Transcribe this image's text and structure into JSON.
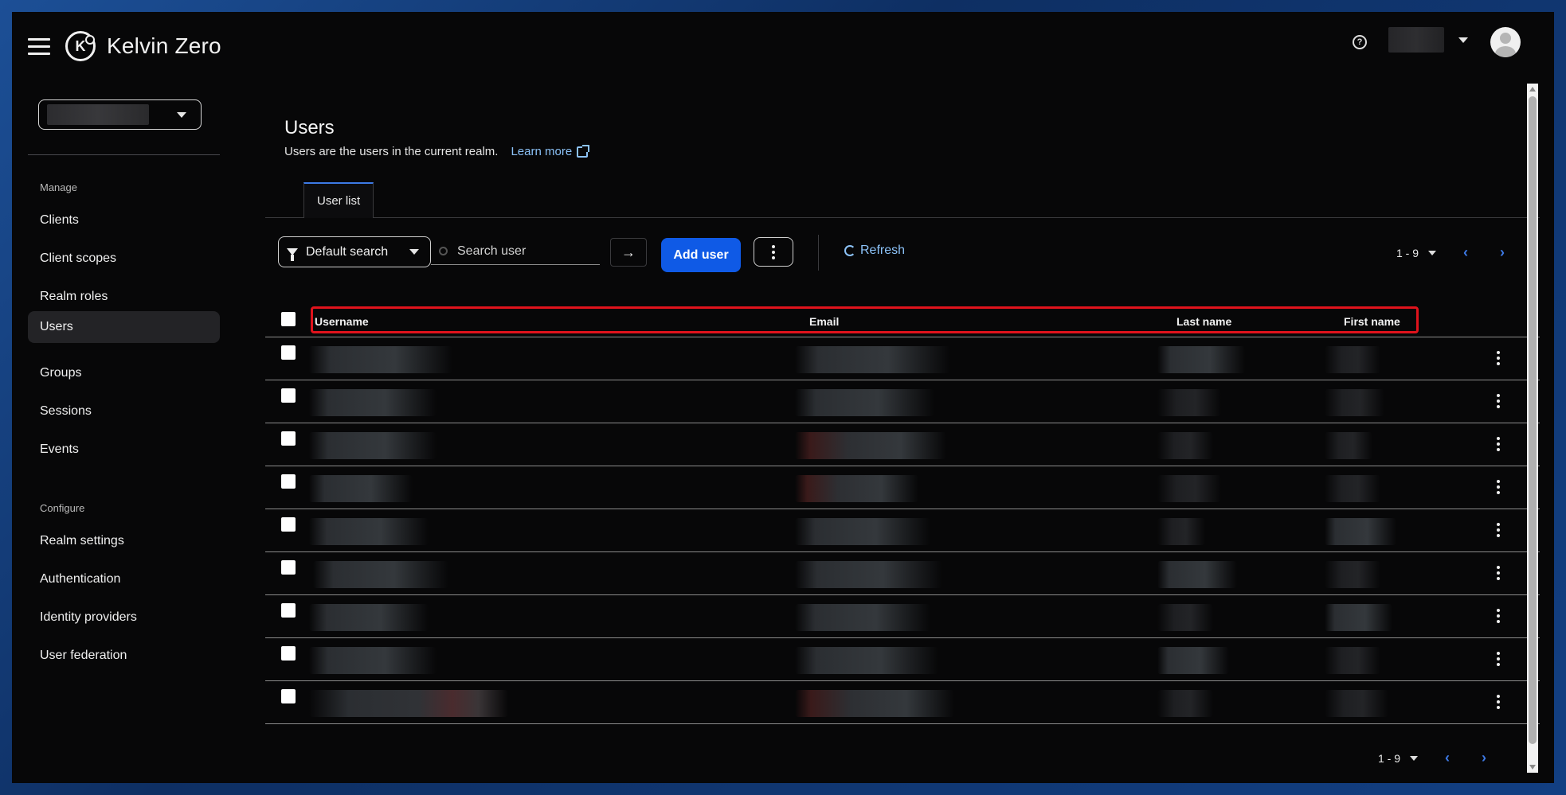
{
  "header": {
    "app_title": "Kelvin Zero",
    "logo_letter": "K",
    "help_icon_glyph": "?"
  },
  "sidebar": {
    "sections": [
      {
        "label": "Manage",
        "items": [
          "Clients",
          "Client scopes",
          "Realm roles",
          "Users",
          "Groups",
          "Sessions",
          "Events"
        ]
      },
      {
        "label": "Configure",
        "items": [
          "Realm settings",
          "Authentication",
          "Identity providers",
          "User federation"
        ]
      }
    ],
    "active_item": "Users"
  },
  "page": {
    "title": "Users",
    "subtitle": "Users are the users in the current realm.",
    "learn_more": "Learn more"
  },
  "tabs": [
    {
      "label": "User list",
      "active": true
    }
  ],
  "toolbar": {
    "filter_label": "Default search",
    "search_placeholder": "Search user",
    "search_go_glyph": "→",
    "add_user_label": "Add user",
    "refresh_label": "Refresh",
    "pagination_range": "1 - 9",
    "prev_glyph": "‹",
    "next_glyph": "›"
  },
  "table": {
    "columns": [
      "Username",
      "Email",
      "Last name",
      "First name"
    ],
    "row_count": 9
  },
  "footer_pagination": {
    "range": "1 - 9"
  },
  "colors": {
    "primary": "#0f5ae6",
    "link": "#8cc2f8",
    "highlight_box": "#e0131c",
    "background": "#070708"
  },
  "icons": {
    "menu": "hamburger-icon",
    "logo": "kelvin-zero-logo-icon",
    "help": "help-icon",
    "avatar": "user-avatar-icon",
    "filter": "filter-icon",
    "search": "search-icon",
    "refresh": "refresh-icon",
    "external_link": "external-link-icon",
    "kebab": "kebab-icon"
  }
}
